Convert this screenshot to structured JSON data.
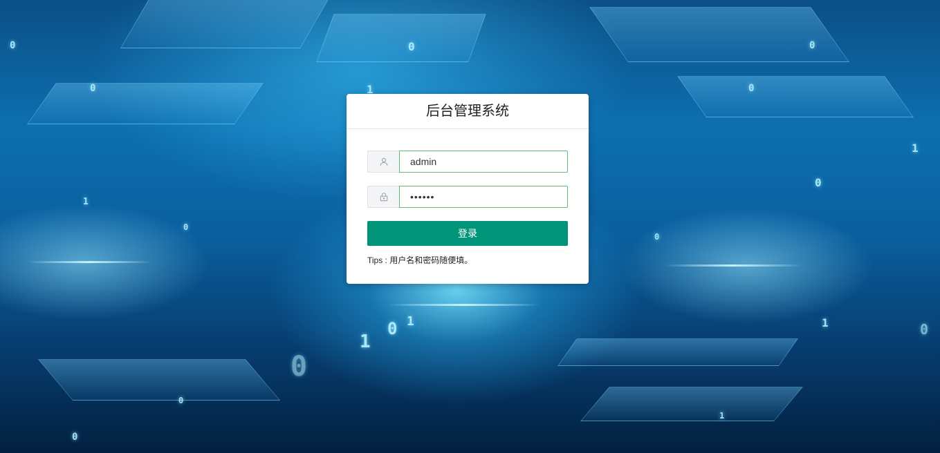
{
  "login": {
    "title": "后台管理系统",
    "username": {
      "icon": "user-icon",
      "value": "admin"
    },
    "password": {
      "icon": "lock-icon",
      "value": "••••••"
    },
    "submit_label": "登录",
    "tips": "Tips : 用户名和密码随便填。"
  },
  "theme": {
    "accent": "#009479",
    "input_border": "#5fb878"
  }
}
